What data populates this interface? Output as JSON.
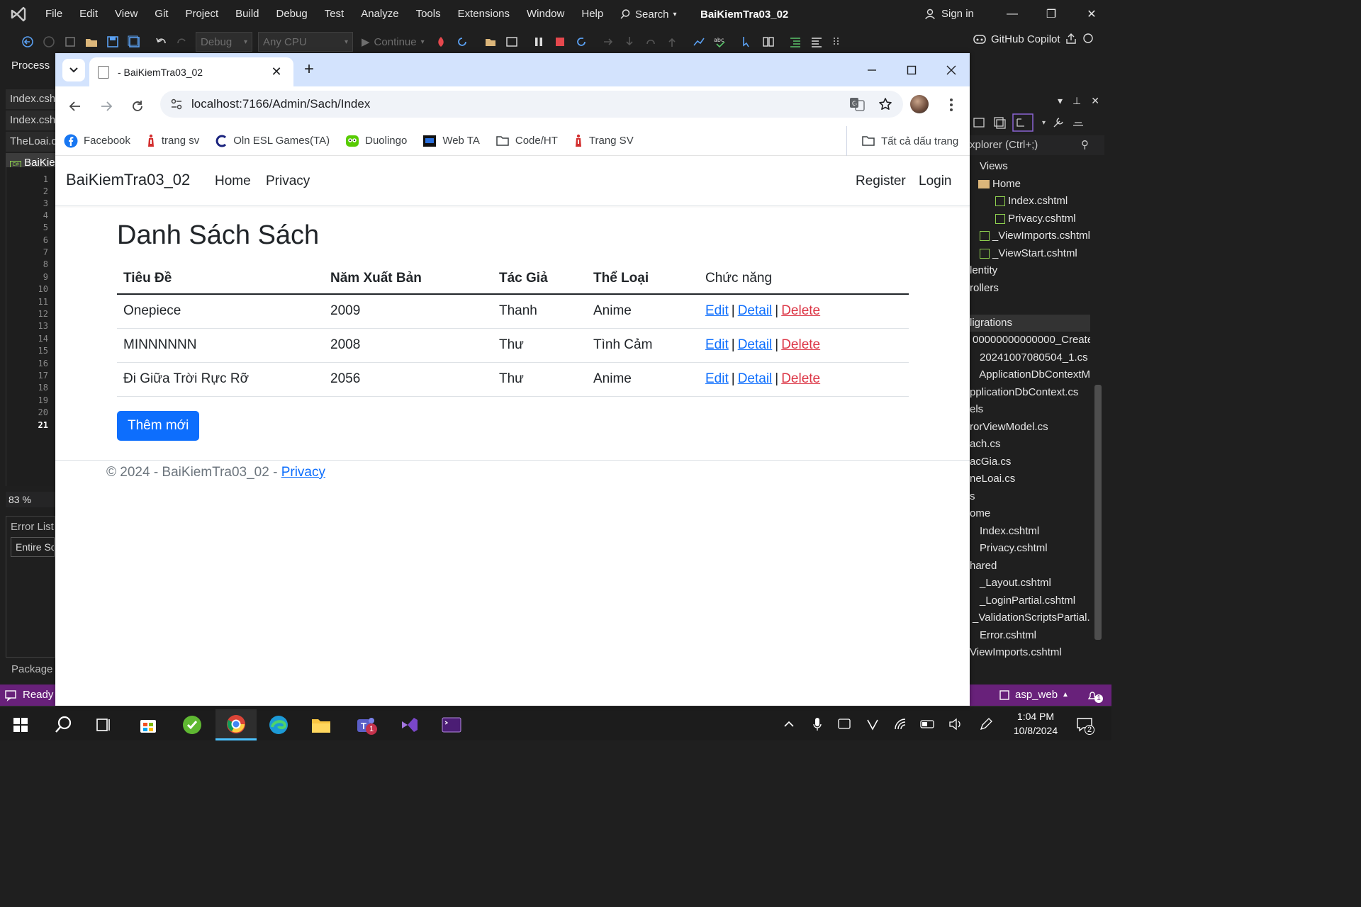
{
  "vs": {
    "menu": [
      "File",
      "Edit",
      "View",
      "Git",
      "Project",
      "Build",
      "Debug",
      "Test",
      "Analyze",
      "Tools",
      "Extensions",
      "Window",
      "Help"
    ],
    "search_label": "Search",
    "title": "BaiKiemTra03_02",
    "sign_in": "Sign in",
    "config_combo": "Debug",
    "platform_combo": "Any CPU",
    "continue_label": "Continue",
    "copilot_label": "GitHub Copilot",
    "process_label": "Process",
    "doc_tabs": [
      "Index.csht",
      "Index.csht",
      "TheLoai.cs",
      "BaiKier"
    ],
    "line_numbers": [
      "1",
      "2",
      "3",
      "4",
      "5",
      "6",
      "7",
      "8",
      "9",
      "10",
      "11",
      "12",
      "13",
      "14",
      "15",
      "16",
      "17",
      "18",
      "19",
      "20",
      "21"
    ],
    "zoom": "83 %",
    "error_list_label": "Error List",
    "error_scope": "Entire Sc",
    "package_label": "Package M",
    "explorer_search": "xplorer (Ctrl+;)",
    "tree": [
      "Views",
      "Home",
      "Index.cshtml",
      "Privacy.cshtml",
      "_ViewImports.cshtml",
      "_ViewStart.cshtml",
      "lentity",
      "rollers",
      "",
      "ligrations",
      "00000000000000_Create",
      "20241007080504_1.cs",
      "ApplicationDbContextM",
      "pplicationDbContext.cs",
      "els",
      "rorViewModel.cs",
      "ach.cs",
      "acGia.cs",
      "neLoai.cs",
      "s",
      "ome",
      "Index.cshtml",
      "Privacy.cshtml",
      "hared",
      "_Layout.cshtml",
      "_LoginPartial.cshtml",
      "_ValidationScriptsPartial.c",
      "Error.cshtml",
      "ViewImports.cshtml"
    ],
    "status_ready": "Ready",
    "status_branch": "asp_web",
    "status_notifications": "1"
  },
  "taskbar": {
    "time": "1:04 PM",
    "date": "10/8/2024",
    "teams_badge": "1",
    "notif_badge": "2"
  },
  "browser": {
    "tab_title": "- BaiKiemTra03_02",
    "url": "localhost:7166/Admin/Sach/Index",
    "bookmarks": [
      "Facebook",
      "trang sv",
      "Oln ESL Games(TA)",
      "Duolingo",
      "Web TA",
      "Code/HT",
      "Trang SV"
    ],
    "all_bookmarks": "Tất cả dấu trang"
  },
  "site": {
    "brand": "BaiKiemTra03_02",
    "nav_home": "Home",
    "nav_privacy": "Privacy",
    "nav_register": "Register",
    "nav_login": "Login",
    "heading": "Danh Sách Sách",
    "columns": [
      "Tiêu Đề",
      "Năm Xuất Bản",
      "Tác Giả",
      "Thể Loại",
      "Chức năng"
    ],
    "rows": [
      {
        "title": "Onepiece",
        "year": "2009",
        "author": "Thanh",
        "genre": "Anime"
      },
      {
        "title": "MINNNNNN",
        "year": "2008",
        "author": "Thư",
        "genre": "Tình Cảm"
      },
      {
        "title": "Đi Giữa Trời Rực Rỡ",
        "year": "2056",
        "author": "Thư",
        "genre": "Anime"
      }
    ],
    "action_edit": "Edit",
    "action_detail": "Detail",
    "action_delete": "Delete",
    "separator": "|",
    "add_button": "Thêm mới",
    "footer_text": "© 2024 - BaiKiemTra03_02 - ",
    "footer_link": "Privacy"
  },
  "colors": {
    "vs_status": "#68217a",
    "bootstrap_primary": "#0d6efd",
    "bootstrap_danger": "#dc3545",
    "chrome_tabstrip": "#d3e3fd"
  }
}
